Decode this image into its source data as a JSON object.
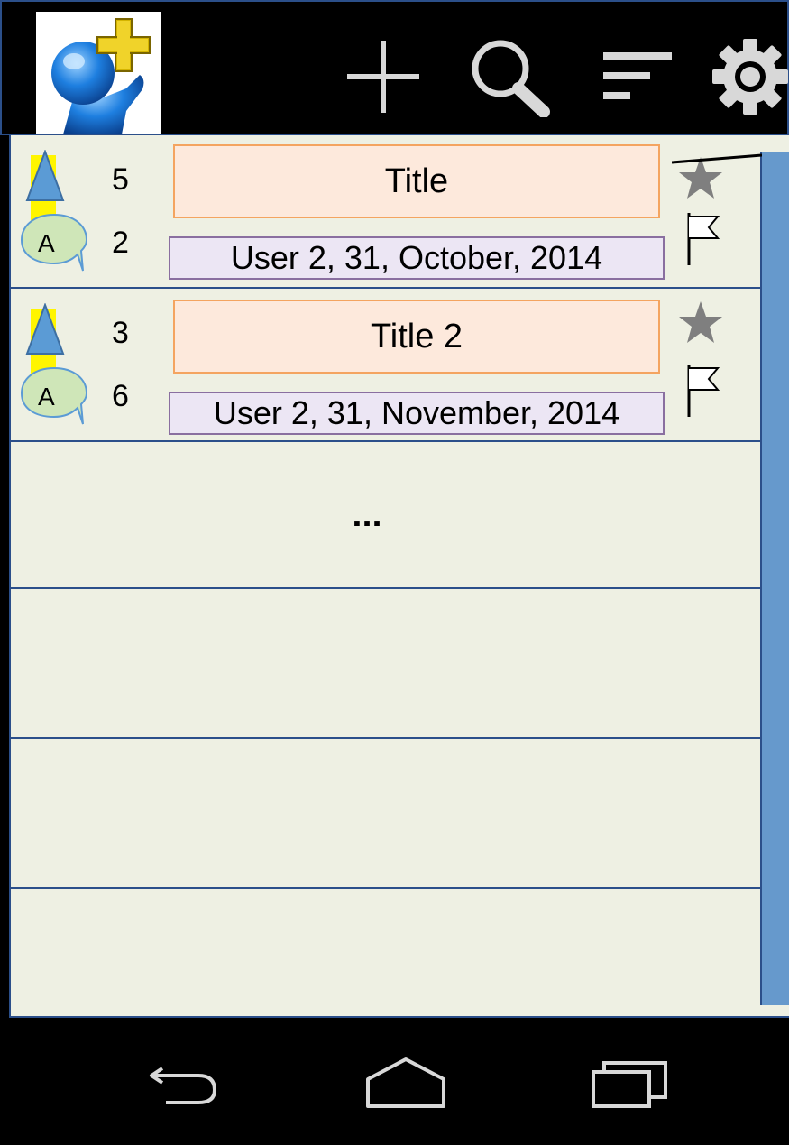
{
  "app": {
    "logo_icon": "user-add-icon",
    "actions": [
      {
        "name": "add",
        "icon": "plus-icon"
      },
      {
        "name": "search",
        "icon": "search-icon"
      },
      {
        "name": "sort",
        "icon": "sort-icon"
      },
      {
        "name": "settings",
        "icon": "gear-icon"
      }
    ]
  },
  "posts": [
    {
      "score": "5",
      "answer_letter": "A",
      "answers": "2",
      "title": "Title",
      "meta": "User 2, 31, October, 2014"
    },
    {
      "score": "3",
      "answer_letter": "A",
      "answers": "6",
      "title": "Title 2",
      "meta": "User 2, 31, November, 2014"
    }
  ],
  "more_indicator": "...",
  "nav": {
    "back_icon": "back-icon",
    "home_icon": "home-icon",
    "recent_icon": "recent-apps-icon"
  },
  "colors": {
    "background": "#eef0e3",
    "title_fill": "#fde9dc",
    "title_border": "#f4a460",
    "meta_fill": "#ece6f4",
    "vote_highlight": "#fff500",
    "scrollbar": "#6699cc",
    "divider": "#2b4f8a"
  }
}
